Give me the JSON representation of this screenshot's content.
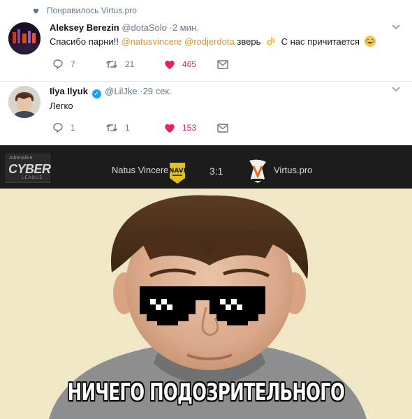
{
  "liked_by": {
    "text": "Понравилось Virtus.pro"
  },
  "tweets": [
    {
      "name": "Aleksey Berezin",
      "handle": "@dotaSolo",
      "time": "·2 мин.",
      "text_before": "Спасибо парни!!",
      "mention_1": "@natusvincere",
      "mention_2": "@rodjerdota",
      "text_mid": "зверь",
      "text_after": "С нас причитается",
      "replies": "7",
      "retweets": "21",
      "likes": "465"
    },
    {
      "name": "Ilya Ilyuk",
      "handle": "@LilJke",
      "time": "·29 сек.",
      "text": "Легко",
      "replies": "1",
      "retweets": "1",
      "likes": "153"
    }
  ],
  "match": {
    "league_top": "Adrenaline",
    "league": "CYBER",
    "league_sub": "LEAGUE",
    "team_left": "Natus Vincere",
    "score": "3:1",
    "team_right": "Virtus.pro"
  },
  "meme": {
    "caption": "НИЧЕГО ПОДОЗРИТЕЛЬНОГО"
  },
  "colors": {
    "like": "#e0245e",
    "mention": "#e0912e",
    "muted": "#657786",
    "band": "#1c1c1c"
  },
  "icons": [
    "heart-icon",
    "verified-icon",
    "chevron-down-icon",
    "reply-icon",
    "retweet-icon",
    "mail-icon"
  ]
}
